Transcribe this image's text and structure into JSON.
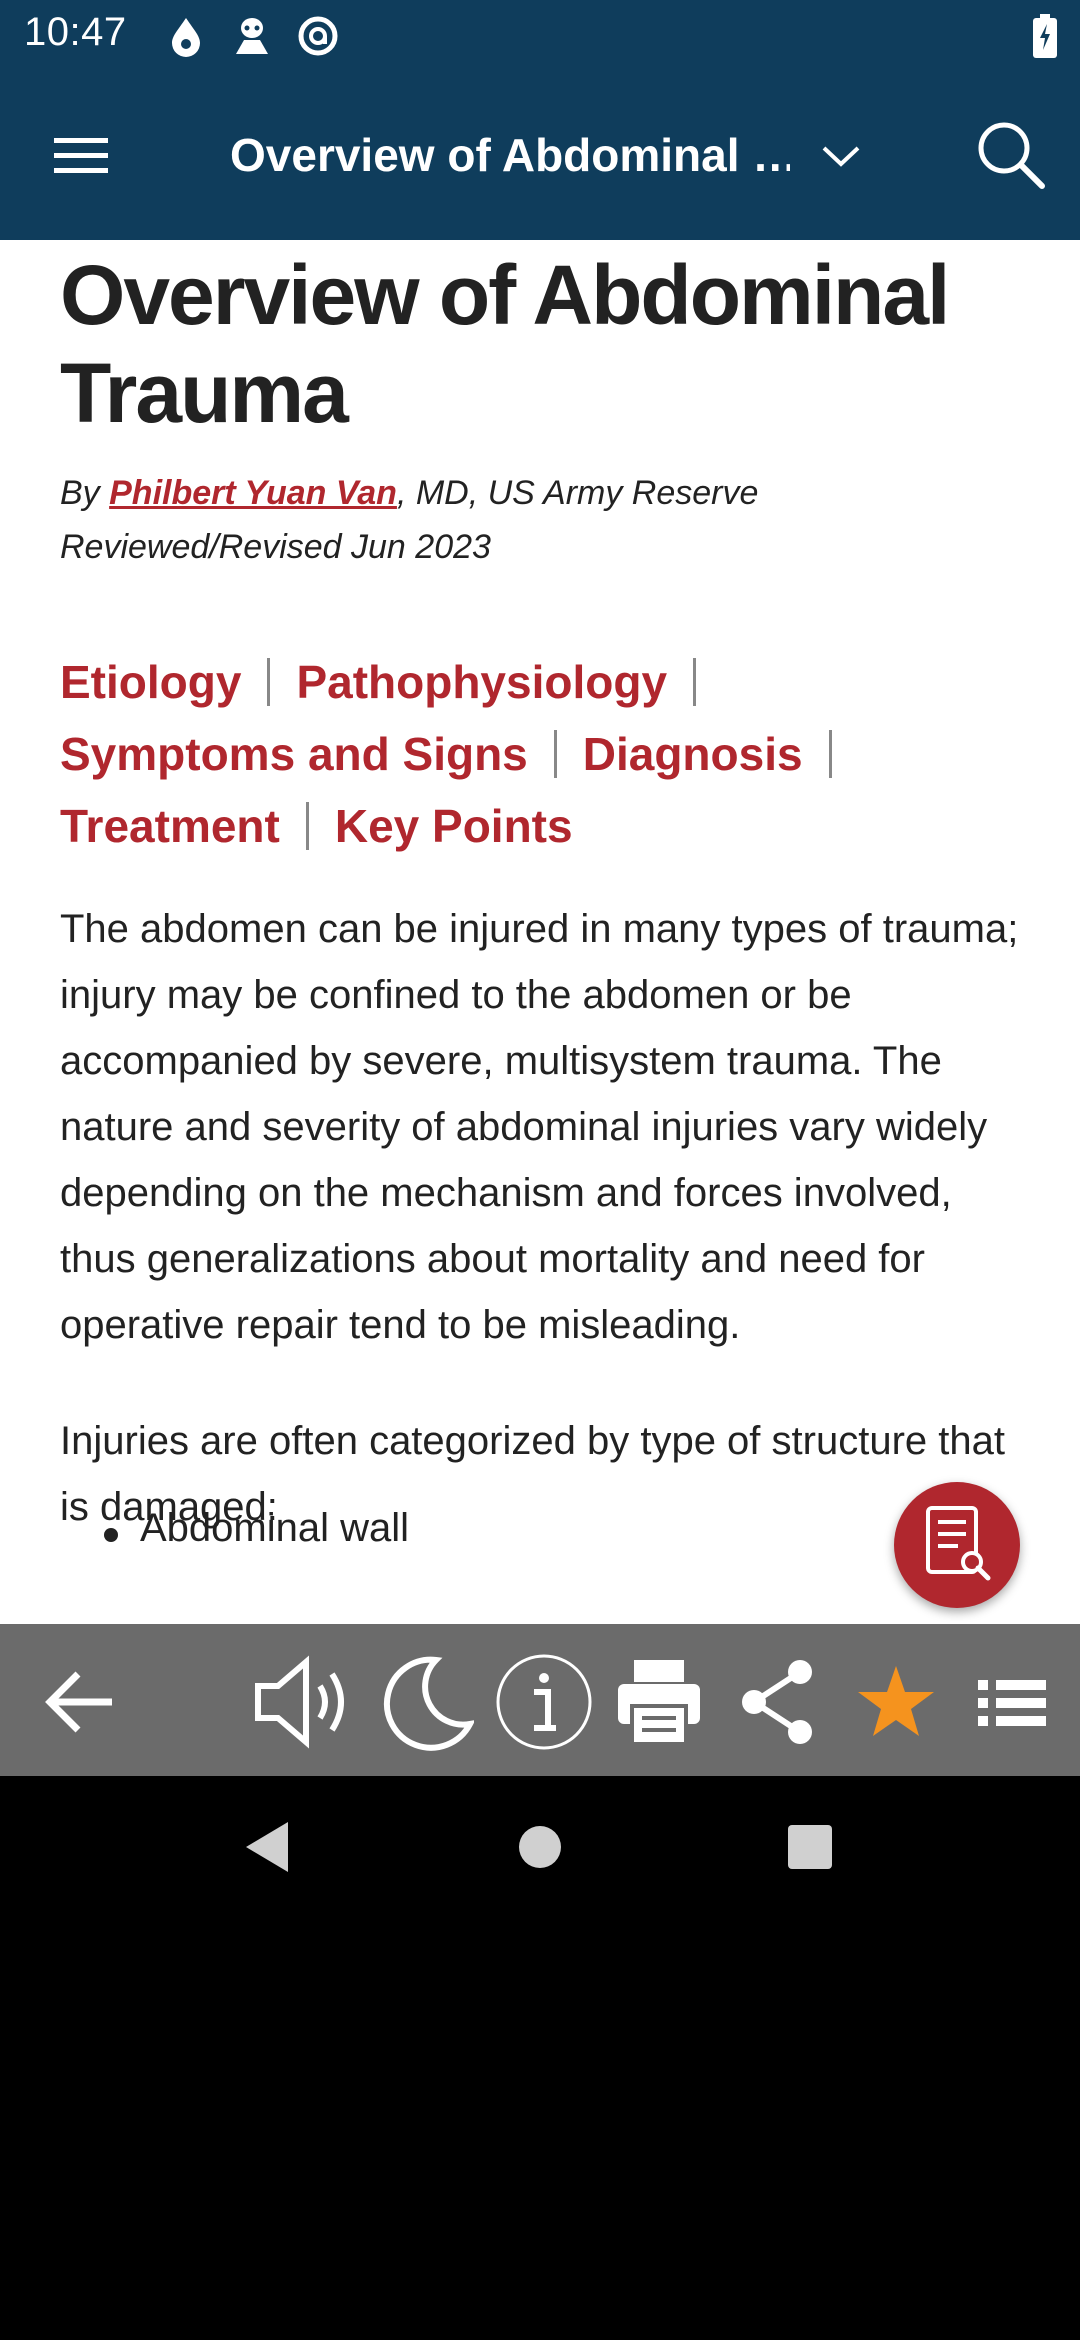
{
  "status_bar": {
    "time": "10:47",
    "icons": [
      "drop-icon",
      "alien-icon",
      "at-sign-icon"
    ],
    "battery": "charging"
  },
  "app_bar": {
    "title": "Overview of Abdominal …",
    "menu_icon": "hamburger-menu-icon",
    "dropdown_icon": "chevron-down-icon",
    "search_icon": "search-icon"
  },
  "article": {
    "title": "Overview of Abdominal Trauma",
    "byline_prefix": "By ",
    "author": "Philbert Yuan Van",
    "author_suffix": ", MD, US Army Reserve",
    "reviewed": "Reviewed/Revised Jun 2023",
    "toc": [
      "Etiology",
      "Pathophysiology",
      "Symptoms and Signs",
      "Diagnosis",
      "Treatment",
      "Key Points"
    ],
    "paragraph1": "The abdomen can be injured in many types of trauma; injury may be confined to the abdomen or be accompanied by severe, multisystem trauma. The nature and severity of abdominal injuries vary widely depending on the mechanism and forces involved, thus generalizations about mortality and need for operative repair tend to be misleading.",
    "paragraph2": "Injuries are often categorized by type of structure that is damaged:",
    "bullets": [
      "Abdominal wall"
    ]
  },
  "toolbar": {
    "items": [
      "back-arrow-icon",
      "speaker-icon",
      "night-mode-icon",
      "info-icon",
      "print-icon",
      "share-icon",
      "favorite-star-icon",
      "list-icon"
    ],
    "star_color": "#f5931e"
  },
  "colors": {
    "header": "#0f3d5c",
    "link": "#b0272e",
    "toolbar": "#6b6b6b"
  }
}
